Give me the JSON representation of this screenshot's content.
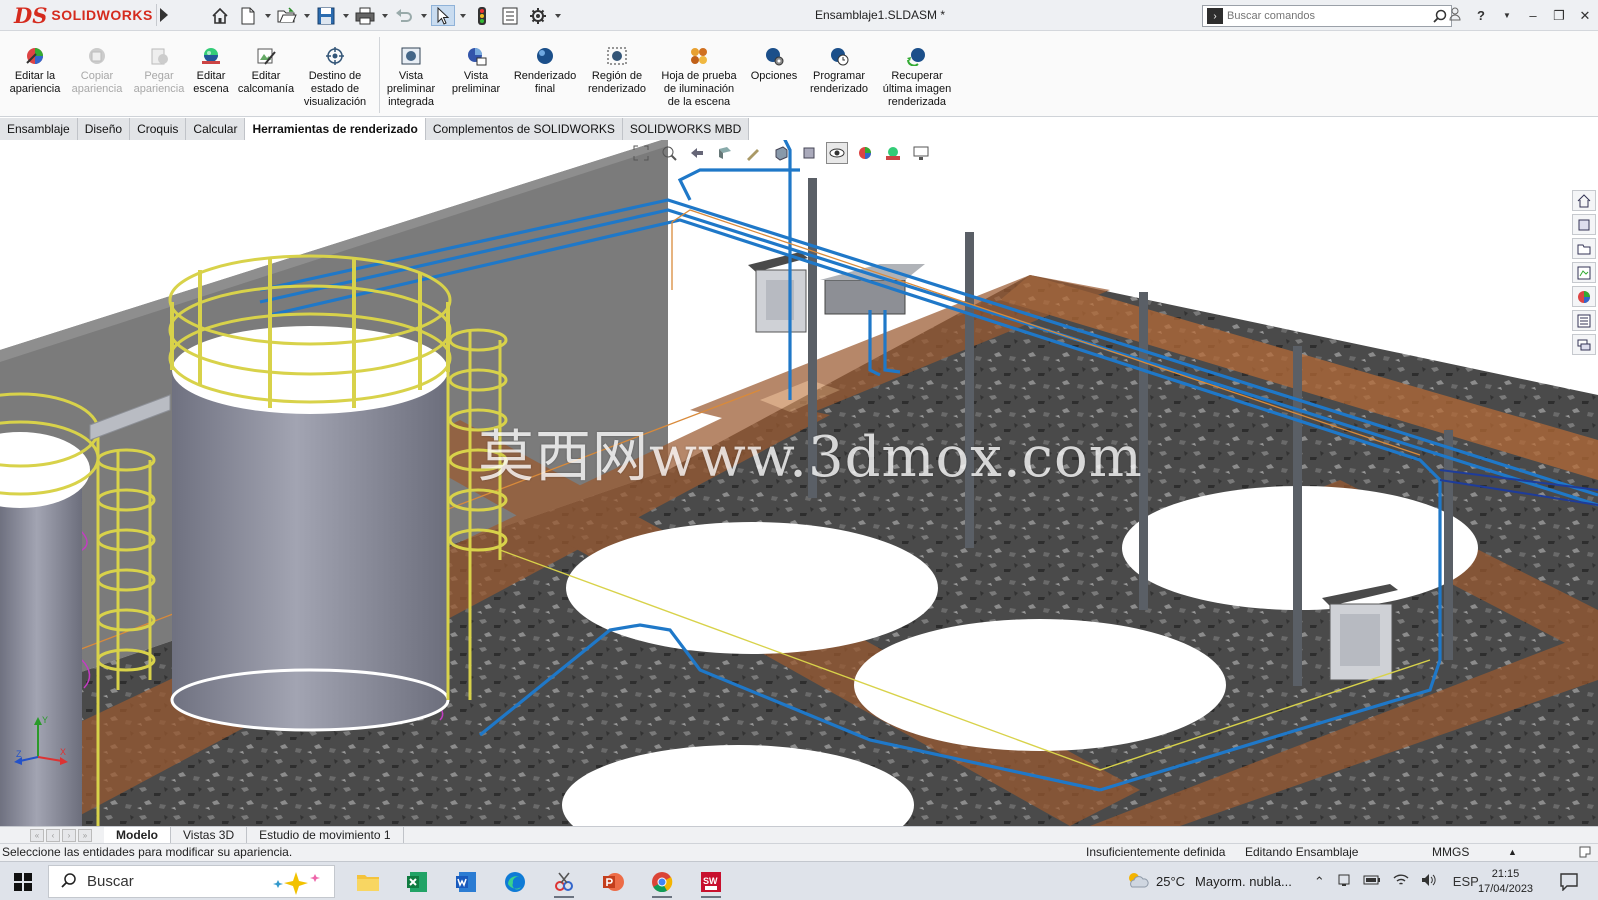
{
  "app": {
    "brand_ds": "DS",
    "brand_name": "SOLIDWORKS",
    "document_title": "Ensamblaje1.SLDASM *",
    "search_placeholder": "Buscar comandos"
  },
  "quick_access": {
    "icons": [
      "home-icon",
      "new-document-icon",
      "open-folder-icon",
      "save-icon",
      "print-icon",
      "undo-icon",
      "select-pointer-icon",
      "traffic-light-icon",
      "file-properties-icon",
      "options-gear-icon"
    ]
  },
  "ribbon": {
    "buttons": [
      {
        "label_lines": [
          "Editar la",
          "apariencia"
        ],
        "icon": "edit-appearance-icon",
        "enabled": true
      },
      {
        "label_lines": [
          "Copiar",
          "apariencia"
        ],
        "icon": "copy-appearance-icon",
        "enabled": false
      },
      {
        "label_lines": [
          "Pegar",
          "apariencia"
        ],
        "icon": "paste-appearance-icon",
        "enabled": false
      },
      {
        "label_lines": [
          "Editar",
          "escena"
        ],
        "icon": "edit-scene-icon",
        "enabled": true
      },
      {
        "label_lines": [
          "Editar",
          "calcomanía"
        ],
        "icon": "edit-decal-icon",
        "enabled": true
      },
      {
        "label_lines": [
          "Destino de",
          "estado de",
          "visualización"
        ],
        "icon": "display-state-target-icon",
        "enabled": true
      },
      {
        "label_lines": [
          "Vista",
          "preliminar",
          "integrada"
        ],
        "icon": "integrated-preview-icon",
        "enabled": true
      },
      {
        "label_lines": [
          "Vista",
          "preliminar"
        ],
        "icon": "preview-window-icon",
        "enabled": true
      },
      {
        "label_lines": [
          "Renderizado",
          "final"
        ],
        "icon": "final-render-icon",
        "enabled": true
      },
      {
        "label_lines": [
          "Región de",
          "renderizado"
        ],
        "icon": "render-region-icon",
        "enabled": true
      },
      {
        "label_lines": [
          "Hoja de prueba",
          "de iluminación",
          "de la escena"
        ],
        "icon": "scene-lighting-proof-icon",
        "enabled": true
      },
      {
        "label_lines": [
          "Opciones"
        ],
        "icon": "render-options-icon",
        "enabled": true
      },
      {
        "label_lines": [
          "Programar",
          "renderizado"
        ],
        "icon": "schedule-render-icon",
        "enabled": true
      },
      {
        "label_lines": [
          "Recuperar",
          "última imagen",
          "renderizada"
        ],
        "icon": "recall-last-render-icon",
        "enabled": true
      }
    ]
  },
  "tabs": [
    {
      "label": "Ensamblaje",
      "active": false
    },
    {
      "label": "Diseño",
      "active": false
    },
    {
      "label": "Croquis",
      "active": false
    },
    {
      "label": "Calcular",
      "active": false
    },
    {
      "label": "Herramientas de renderizado",
      "active": true
    },
    {
      "label": "Complementos de SOLIDWORKS",
      "active": false
    },
    {
      "label": "SOLIDWORKS MBD",
      "active": false
    }
  ],
  "viewport": {
    "watermark": "莫西网www.3dmox.com",
    "heads_up_icons": [
      "zoom-to-fit-icon",
      "zoom-to-area-icon",
      "previous-view-icon",
      "section-view-icon",
      "dynamic-annotation-icon",
      "view-orientation-icon",
      "display-style-icon",
      "hide-show-items-icon",
      "edit-appearance-icon",
      "apply-scene-icon",
      "view-settings-icon"
    ],
    "task_pane_icons": [
      "resources-home-icon",
      "design-library-icon",
      "file-explorer-icon",
      "view-palette-icon",
      "appearances-icon",
      "custom-properties-icon",
      "forum-icon"
    ]
  },
  "bottom_tabs": [
    {
      "label": "Modelo",
      "active": true
    },
    {
      "label": "Vistas 3D",
      "active": false
    },
    {
      "label": "Estudio de movimiento 1",
      "active": false
    }
  ],
  "status": {
    "message": "Seleccione las entidades para modificar su apariencia.",
    "definition": "Insuficientemente definida",
    "mode": "Editando Ensamblaje",
    "units": "MMGS"
  },
  "taskbar": {
    "search_label": "Buscar",
    "apps": [
      "file-explorer-icon",
      "excel-icon",
      "word-icon",
      "edge-icon",
      "snipping-tool-icon",
      "powerpoint-icon",
      "chrome-icon",
      "solidworks-icon"
    ],
    "weather_temp": "25°C",
    "weather_text": "Mayorm. nubla...",
    "language": "ESP",
    "time": "21:15",
    "date": "17/04/2023"
  },
  "colors": {
    "brand_red": "#d52b1e",
    "pipe_blue": "#1f78c8",
    "railing_yellow": "#d8d24a",
    "trench_brown": "#9b5a30",
    "tank_gray": "#8d8f9c",
    "wall_gray": "#7a7a7a"
  }
}
